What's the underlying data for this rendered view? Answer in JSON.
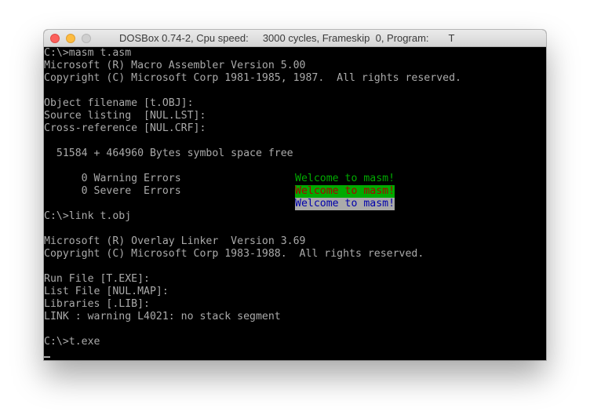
{
  "window": {
    "title": "DOSBox 0.74-2, Cpu speed:     3000 cycles, Frameskip  0, Program:       T"
  },
  "console": {
    "lines": [
      "C:\\>masm t.asm",
      "Microsoft (R) Macro Assembler Version 5.00",
      "Copyright (C) Microsoft Corp 1981-1985, 1987.  All rights reserved.",
      "",
      "Object filename [t.OBJ]:",
      "Source listing  [NUL.LST]:",
      "Cross-reference [NUL.CRF]:",
      "",
      "  51584 + 464960 Bytes symbol space free",
      "",
      "      0 Warning Errors",
      "      0 Severe  Errors",
      "",
      "C:\\>link t.obj",
      "",
      "Microsoft (R) Overlay Linker  Version 3.69",
      "Copyright (C) Microsoft Corp 1983-1988.  All rights reserved.",
      "",
      "Run File [T.EXE]:",
      "List File [NUL.MAP]:",
      "Libraries [.LIB]:",
      "LINK : warning L4021: no stack segment",
      "",
      "C:\\>t.exe"
    ],
    "welcome_messages": [
      {
        "text": "Welcome to masm!",
        "fg": "#00aa00",
        "bg": "#000000"
      },
      {
        "text": "Welcome to masm!",
        "fg": "#aa0000",
        "bg": "#00aa00"
      },
      {
        "text": "Welcome to masm!",
        "fg": "#0000aa",
        "bg": "#aaaaaa"
      }
    ]
  },
  "colors": {
    "text": "#aaaaaa",
    "background": "#000000"
  }
}
